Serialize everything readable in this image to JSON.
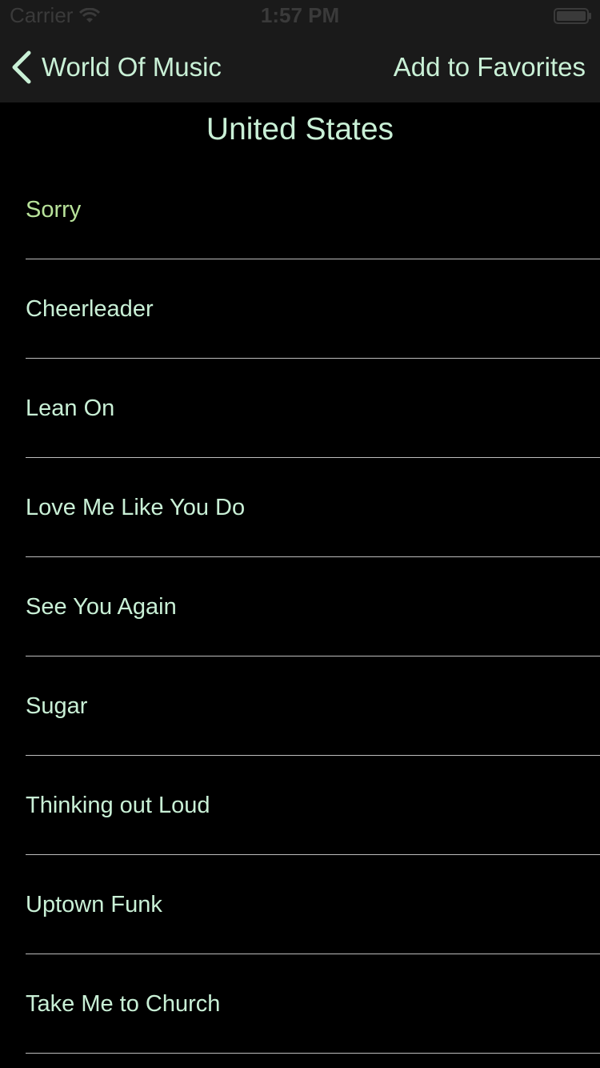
{
  "status_bar": {
    "carrier": "Carrier",
    "time": "1:57 PM",
    "wifi_icon": "wifi-icon",
    "battery_icon": "battery-icon"
  },
  "nav": {
    "back_label": "World Of Music",
    "back_icon": "chevron-left-icon",
    "action_label": "Add to Favorites"
  },
  "country": "United States",
  "songs": [
    "Sorry",
    "Cheerleader",
    "Lean On",
    "Love Me Like You Do",
    "See You Again",
    "Sugar",
    "Thinking out Loud",
    "Uptown Funk",
    "Take Me to Church"
  ],
  "colors": {
    "accent": "#c9f0d6",
    "selected_row_text": "#b8e29a",
    "background": "#000000",
    "bar_background": "#1a1a1a"
  }
}
